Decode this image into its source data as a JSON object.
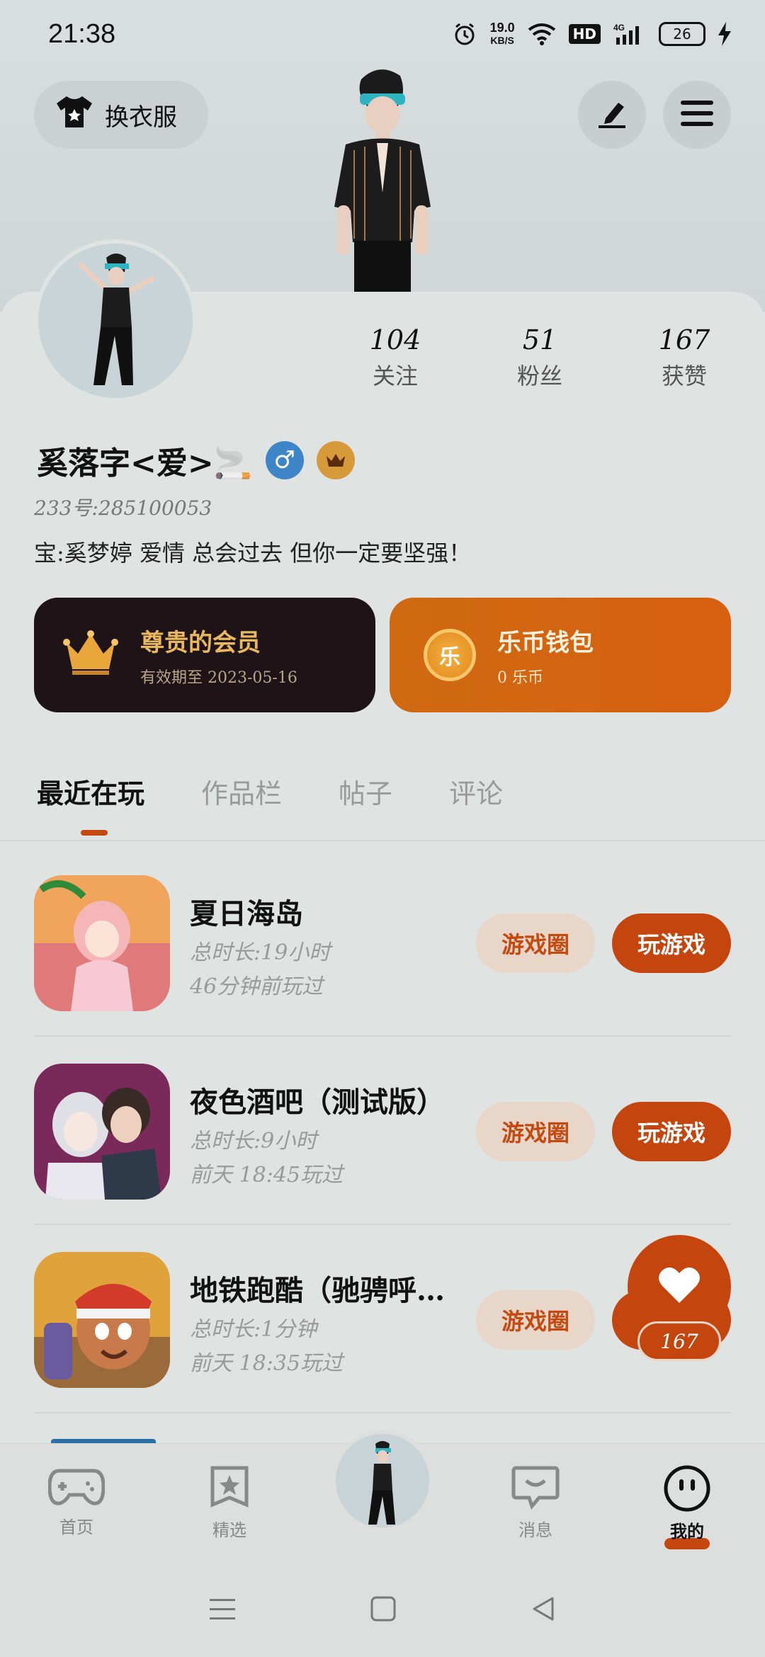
{
  "status_bar": {
    "time": "21:38",
    "net_speed_value": "19.0",
    "net_speed_unit": "KB/S",
    "hd": "HD",
    "network": "4G",
    "battery": "26"
  },
  "header": {
    "outfit_label": "换衣服"
  },
  "profile": {
    "following_count": "104",
    "following_label": "关注",
    "fans_count": "51",
    "fans_label": "粉丝",
    "likes_count": "167",
    "likes_label": "获赞",
    "username": "奚落字<爱>🚬",
    "uid": "233号:285100053",
    "bio": "宝:奚梦婷 爱情  总会过去  但你一定要坚强！"
  },
  "cards": {
    "member_title": "尊贵的会员",
    "member_subtitle": "有效期至 2023-05-16",
    "wallet_title": "乐币钱包",
    "wallet_subtitle": "0 乐币",
    "wallet_coin": "乐"
  },
  "tabs": [
    {
      "label": "最近在玩"
    },
    {
      "label": "作品栏"
    },
    {
      "label": "帖子"
    },
    {
      "label": "评论"
    }
  ],
  "games": [
    {
      "name": "夏日海岛",
      "duration": "总时长:19小时",
      "last_played": "46分钟前玩过",
      "circle_label": "游戏圈",
      "play_label": "玩游戏"
    },
    {
      "name": "夜色酒吧（测试版）",
      "duration": "总时长:9小时",
      "last_played": "前天 18:45玩过",
      "circle_label": "游戏圈",
      "play_label": "玩游戏"
    },
    {
      "name": "地铁跑酷（驰骋呼…",
      "duration": "总时长:1分钟",
      "last_played": "前天 18:35玩过",
      "circle_label": "游戏圈"
    }
  ],
  "like_fab": {
    "count": "167"
  },
  "bottom_nav": {
    "home": "首页",
    "featured": "精选",
    "messages": "消息",
    "mine": "我的"
  },
  "colors": {
    "accent": "#c4460e",
    "member_bg": "#1e1418",
    "wallet_bg": "#d26511",
    "gender_male": "#3d85c6"
  }
}
